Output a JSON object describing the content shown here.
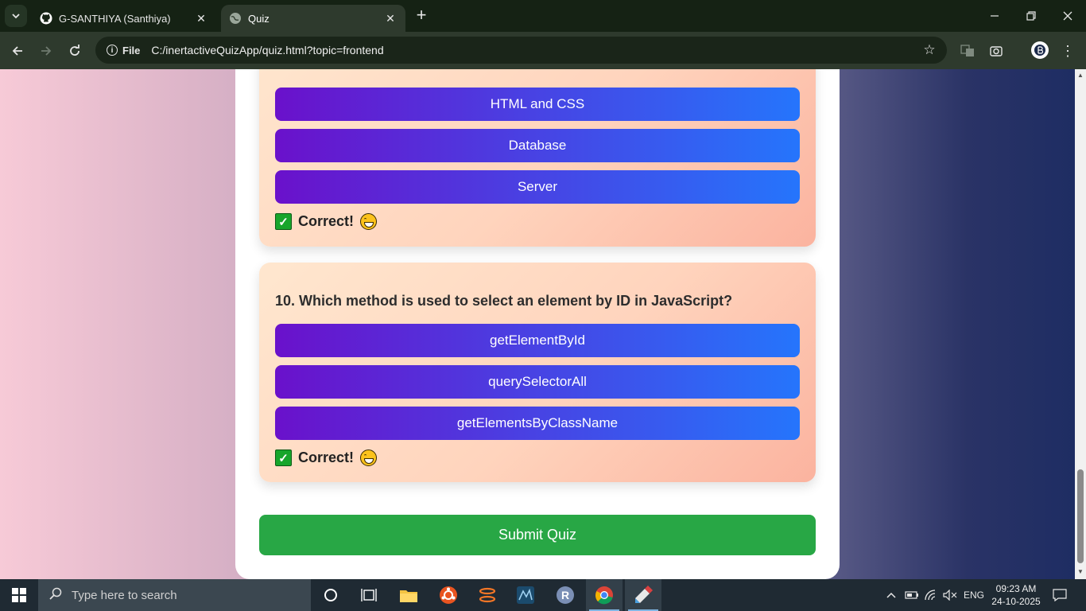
{
  "browser": {
    "tabs": [
      {
        "title": "G-SANTHIYA (Santhiya)",
        "icon": "github-icon"
      },
      {
        "title": "Quiz",
        "icon": "globe-icon"
      }
    ],
    "address": {
      "scheme_label": "File",
      "url": "C:/inertactiveQuizApp/quiz.html?topic=frontend"
    }
  },
  "quiz": {
    "questions": [
      {
        "options": [
          "HTML and CSS",
          "Database",
          "Server"
        ],
        "feedback": "Correct!"
      },
      {
        "text": "10. Which method is used to select an element by ID in JavaScript?",
        "options": [
          "getElementById",
          "querySelectorAll",
          "getElementsByClassName"
        ],
        "feedback": "Correct!"
      }
    ],
    "submit_label": "Submit Quiz"
  },
  "colors": {
    "option_gradient_start": "#6a11cb",
    "option_gradient_end": "#2575fc",
    "submit_bg": "#28a745",
    "card_gradient_start": "#ffe7cf",
    "card_gradient_end": "#fbb39f"
  },
  "taskbar": {
    "search_placeholder": "Type here to search",
    "language": "ENG",
    "time": "09:23 AM",
    "date": "24-10-2025"
  }
}
